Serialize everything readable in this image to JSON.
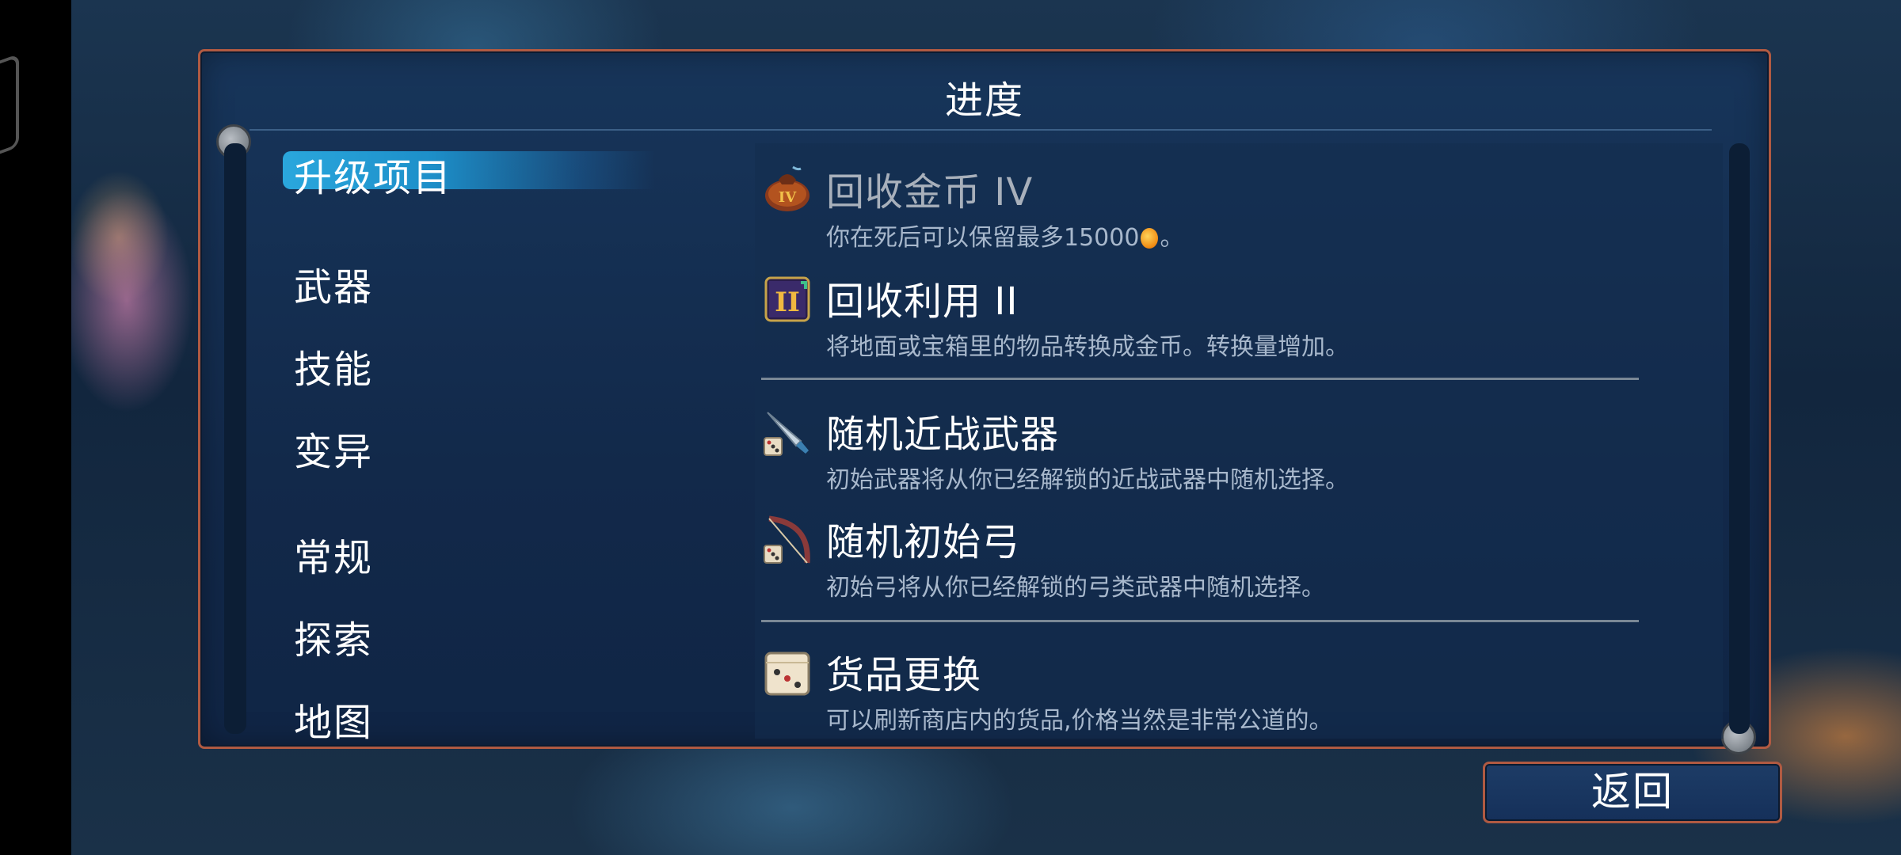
{
  "panel": {
    "title": "进度"
  },
  "categories": [
    {
      "label": "升级项目",
      "selected": true
    },
    {
      "label": "武器"
    },
    {
      "label": "技能"
    },
    {
      "label": "变异"
    },
    {
      "label": "常规"
    },
    {
      "label": "探索"
    },
    {
      "label": "地图"
    }
  ],
  "items": [
    {
      "icon": "coin-bag-icon",
      "title": "回收金币 IV",
      "desc_before_coin": "你在死后可以保留最多15000",
      "desc_after_coin": "。",
      "inline_icon": "coin-icon"
    },
    {
      "icon": "recycle-scroll-icon",
      "title": "回收利用 II",
      "desc": "将地面或宝箱里的物品转换成金币。转换量增加。"
    },
    {
      "icon": "random-melee-weapon-icon",
      "title": "随机近战武器",
      "desc": "初始武器将从你已经解锁的近战武器中随机选择。"
    },
    {
      "icon": "random-bow-icon",
      "title": "随机初始弓",
      "desc": "初始弓将从你已经解锁的弓类武器中随机选择。"
    },
    {
      "icon": "dice-icon",
      "title": "货品更换",
      "desc": "可以刷新商店内的货品,价格当然是非常公道的。"
    }
  ],
  "footer": {
    "back_label": "返回"
  },
  "colors": {
    "accent": "#2aa7dd",
    "frame": "#b05a42",
    "coin": "#f08a12"
  }
}
